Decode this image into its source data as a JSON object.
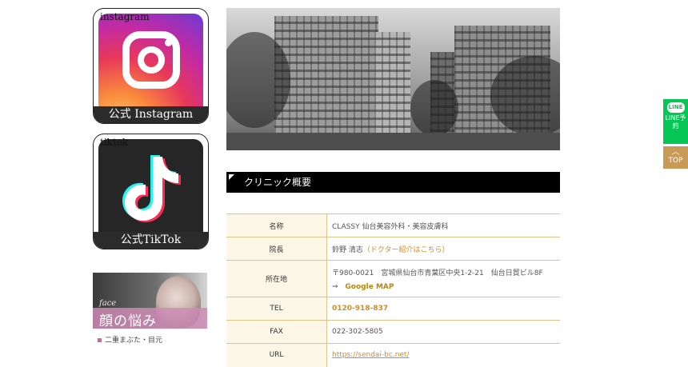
{
  "sidebar": {
    "instagram": {
      "tag": "instagram",
      "label": "公式 Instagram"
    },
    "tiktok": {
      "tag": "tiktok",
      "label": "公式TikTok"
    },
    "face_banner": {
      "sub": "face",
      "title": "顔の悩み"
    },
    "face_link": "二重まぶた・目元"
  },
  "section": {
    "title": "クリニック概要"
  },
  "info": {
    "rows": [
      {
        "key": "名称",
        "value": "CLASSY 仙台美容外科・美容皮膚科"
      },
      {
        "key": "院長",
        "value": "鈴野 清志",
        "link": "（ドクター紹介はこちら）"
      },
      {
        "key": "所在地",
        "value": "〒980-0021　宮城県仙台市青葉区中央1-2-21　仙台日貿ビル8F",
        "arrow": "⇒",
        "map": "Google MAP"
      },
      {
        "key": "TEL",
        "value": "0120-918-837"
      },
      {
        "key": "FAX",
        "value": "022-302-5805"
      },
      {
        "key": "URL",
        "value": "https://sendai-bc.net/"
      }
    ]
  },
  "float": {
    "line_logo": "LINE",
    "line_label": "LINE予約",
    "top_label": "TOP"
  },
  "colors": {
    "accent": "#d58a2b",
    "line_green": "#06c755",
    "table_border": "#e2c28b",
    "top_button": "#c99a55"
  }
}
